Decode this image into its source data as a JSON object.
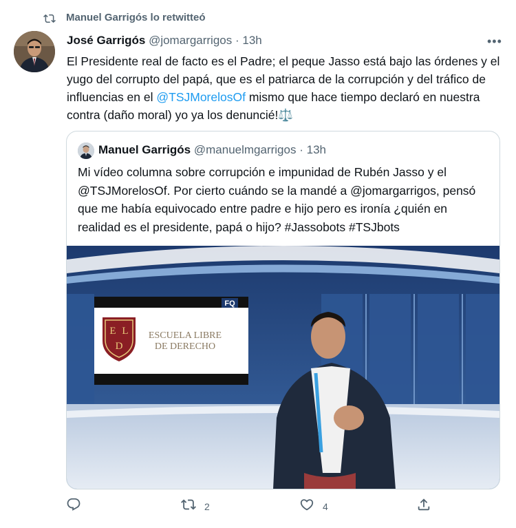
{
  "retweet": {
    "icon": "retweet-icon",
    "text": "Manuel Garrigós lo retwitteó"
  },
  "tweet": {
    "avatar": "author-avatar",
    "name": "José Garrigós",
    "handle": "@jomargarrigos",
    "separator": "·",
    "time": "13h",
    "more_icon": "more-icon",
    "more_label": "•••",
    "text_parts": {
      "p1": "El Presidente real de facto es el Padre; el peque Jasso está bajo las órdenes y el yugo del corrupto del papá, que es el patriarca de la corrupción y del tráfico de influencias en el ",
      "mention": "@TSJMorelosOf",
      "p2": " mismo que hace tiempo declaró en nuestra contra (daño moral) yo ya los denuncié!",
      "emoji": "⚖️"
    }
  },
  "quote": {
    "avatar": "quoted-author-avatar",
    "name": "Manuel Garrigós",
    "handle": "@manuelmgarrigos",
    "separator": "·",
    "time": "13h",
    "text": "Mi vídeo columna sobre corrupción e impunidad de Rubén Jasso y el @TSJMorelosOf. Por cierto cuándo se la mandé a @jomargarrigos, pensó que me había equivocado entre padre e hijo pero es ironía ¿quién en realidad es el presidente, papá o hijo? #Jassobots #TSJbots",
    "media": {
      "icon": "video-thumbnail",
      "screen_logo_letters": [
        "E",
        "L",
        "D"
      ],
      "screen_text_line1": "ESCUELA LIBRE",
      "screen_text_line2": "DE DERECHO",
      "corner_logo": "FQ"
    }
  },
  "actions": {
    "reply": {
      "icon": "reply-icon",
      "count": ""
    },
    "retweet": {
      "icon": "retweet-icon",
      "count": "2"
    },
    "like": {
      "icon": "heart-icon",
      "count": "4"
    },
    "share": {
      "icon": "share-icon",
      "count": ""
    }
  },
  "colors": {
    "link": "#1d9bf0",
    "secondary": "#536471",
    "border": "#cfd9de",
    "text": "#0f1419"
  }
}
